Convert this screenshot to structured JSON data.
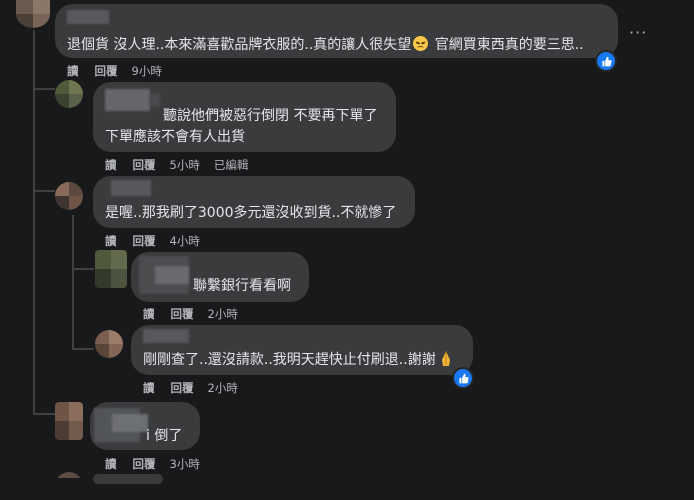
{
  "comments": [
    {
      "text_before": "退個貨 沒人理..本來滿喜歡品牌衣服的..真的讓人很失望",
      "emoji": "disappointed-face",
      "text_after": " 官網買東西真的要三思..",
      "reply_label": "讀",
      "respond_label": "回覆",
      "time": "9小時"
    },
    {
      "name_tail": "聽說他們被惡行倒閉",
      "line1_rest": " 不要再下單了",
      "line2": "下單應該不會有人出貨",
      "reply_label": "讀",
      "respond_label": "回覆",
      "time": "5小時",
      "edited": "已編輯"
    },
    {
      "text": "是喔..那我刷了3000多元還沒收到貨..不就慘了",
      "reply_label": "讀",
      "respond_label": "回覆",
      "time": "4小時"
    },
    {
      "text": "聯繫銀行看看啊",
      "reply_label": "讀",
      "respond_label": "回覆",
      "time": "2小時"
    },
    {
      "text": "剛剛查了..還沒請款..我明天趕快止付刷退..謝謝",
      "emoji": "folded-hands",
      "reply_label": "讀",
      "respond_label": "回覆",
      "time": "2小時"
    },
    {
      "text": "i 倒了",
      "reply_label": "讀",
      "respond_label": "回覆",
      "time": "3小時"
    }
  ],
  "more_icon": "more-horizontal-icon",
  "like_icon": "thumbs-up-icon",
  "colors": {
    "background": "#18191a",
    "bubble": "#3a3b3c",
    "like": "#1877f2",
    "meta": "#b0b3b8"
  }
}
